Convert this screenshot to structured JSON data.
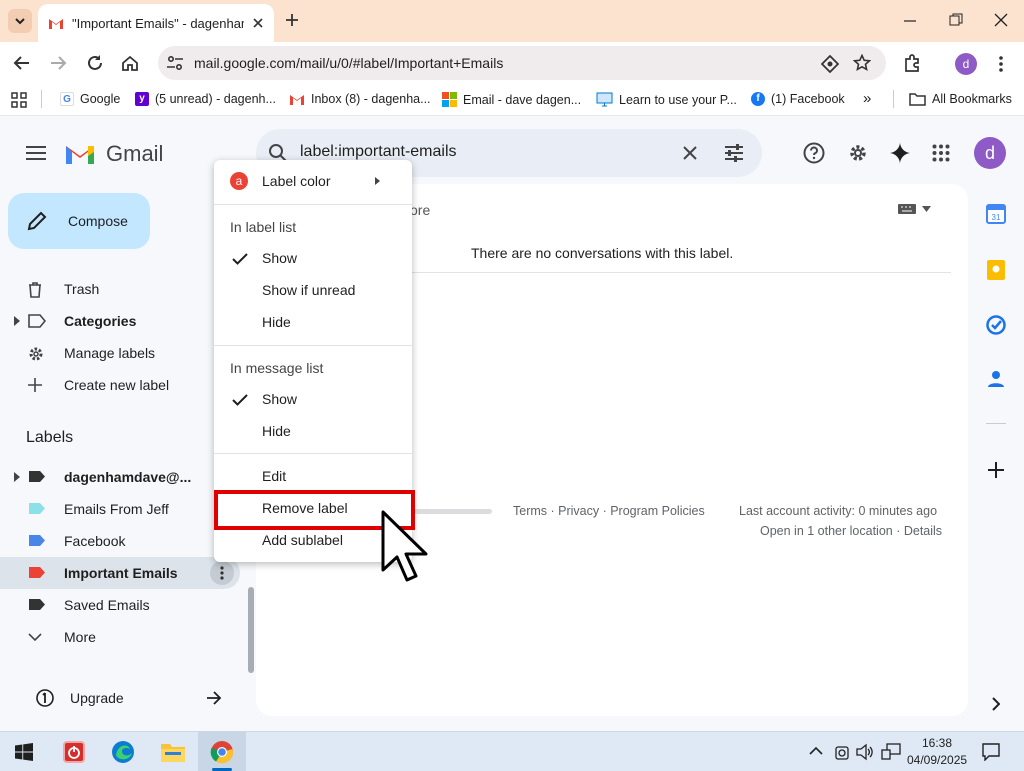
{
  "browser": {
    "tab_title": "\"Important Emails\" - dagenham",
    "url": "mail.google.com/mail/u/0/#label/Important+Emails",
    "profile_initial": "d",
    "bookmarks": [
      {
        "label": "Google",
        "color": "#4285f4",
        "glyph": "G"
      },
      {
        "label": "(5 unread) - dagenh...",
        "color": "#6001d2",
        "glyph": "y"
      },
      {
        "label": "Inbox (8) - dagenha...",
        "color": "#ea4335",
        "glyph": "M"
      },
      {
        "label": "Email - dave dagen...",
        "color": "#f25022",
        "glyph": ""
      },
      {
        "label": "Learn to use your P...",
        "color": "#0078d4",
        "glyph": ""
      },
      {
        "label": "(1) Facebook",
        "color": "#1877f2",
        "glyph": "f"
      }
    ],
    "bookmarks_overflow": "»",
    "all_bookmarks": "All Bookmarks"
  },
  "gmail": {
    "logo_text": "Gmail",
    "search_query": "label:important-emails",
    "avatar_initial": "d",
    "compose": "Compose",
    "nav": [
      {
        "label": "Trash",
        "icon": "trash-icon",
        "bold": false
      },
      {
        "label": "Categories",
        "icon": "label-outline-icon",
        "bold": true
      },
      {
        "label": "Manage labels",
        "icon": "gear-icon",
        "bold": false
      },
      {
        "label": "Create new label",
        "icon": "plus-icon",
        "bold": false
      }
    ],
    "labels_heading": "Labels",
    "labels": [
      {
        "label": "dagenhamdave@...",
        "color": "#333333",
        "bold": true
      },
      {
        "label": "Emails From Jeff",
        "color": "#8ce0e8",
        "bold": false
      },
      {
        "label": "Facebook",
        "color": "#4a86e8",
        "bold": false
      },
      {
        "label": "Important Emails",
        "color": "#ea4335",
        "bold": true
      },
      {
        "label": "Saved Emails",
        "color": "#333333",
        "bold": false
      }
    ],
    "more": "More",
    "upgrade": "Upgrade",
    "toolbar_more_fragment": "ore",
    "empty_message": "There are no conversations with this label.",
    "footer_links": "Terms · Privacy · Program Policies",
    "last_activity": "Last account activity: 0 minutes ago",
    "open_locations": "Open in 1 other location · Details"
  },
  "menu": {
    "label_color": "Label color",
    "color_badge": "a",
    "in_label_list": "In label list",
    "label_list_options": [
      "Show",
      "Show if unread",
      "Hide"
    ],
    "in_message_list": "In message list",
    "message_list_options": [
      "Show",
      "Hide"
    ],
    "edit": "Edit",
    "remove_label": "Remove label",
    "add_sublabel": "Add sublabel"
  },
  "taskbar": {
    "time": "16:38",
    "date": "04/09/2025"
  },
  "colors": {
    "accent_highlight": "#e00000",
    "compose_bg": "#c2e7ff",
    "avatar": "#8e5bc6"
  }
}
